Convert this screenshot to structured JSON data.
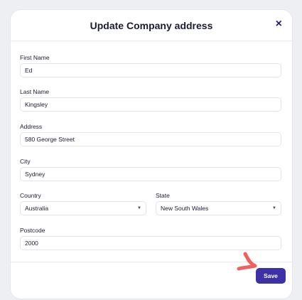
{
  "modal": {
    "title": "Update Company address",
    "close_label": "×"
  },
  "form": {
    "first_name": {
      "label": "First Name",
      "value": "Ed"
    },
    "last_name": {
      "label": "Last Name",
      "value": "Kingsley"
    },
    "address": {
      "label": "Address",
      "value": "580 George Street"
    },
    "city": {
      "label": "City",
      "value": "Sydney"
    },
    "country": {
      "label": "Country",
      "value": "Australia"
    },
    "state": {
      "label": "State",
      "value": "New South Wales"
    },
    "postcode": {
      "label": "Postcode",
      "value": "2000"
    }
  },
  "footer": {
    "save_label": "Save"
  },
  "icons": {
    "caret": "chevron-down-icon",
    "annotation": "arrow-annotation-icon"
  },
  "colors": {
    "accent": "#3d31a8",
    "annotation": "#f0605c"
  }
}
